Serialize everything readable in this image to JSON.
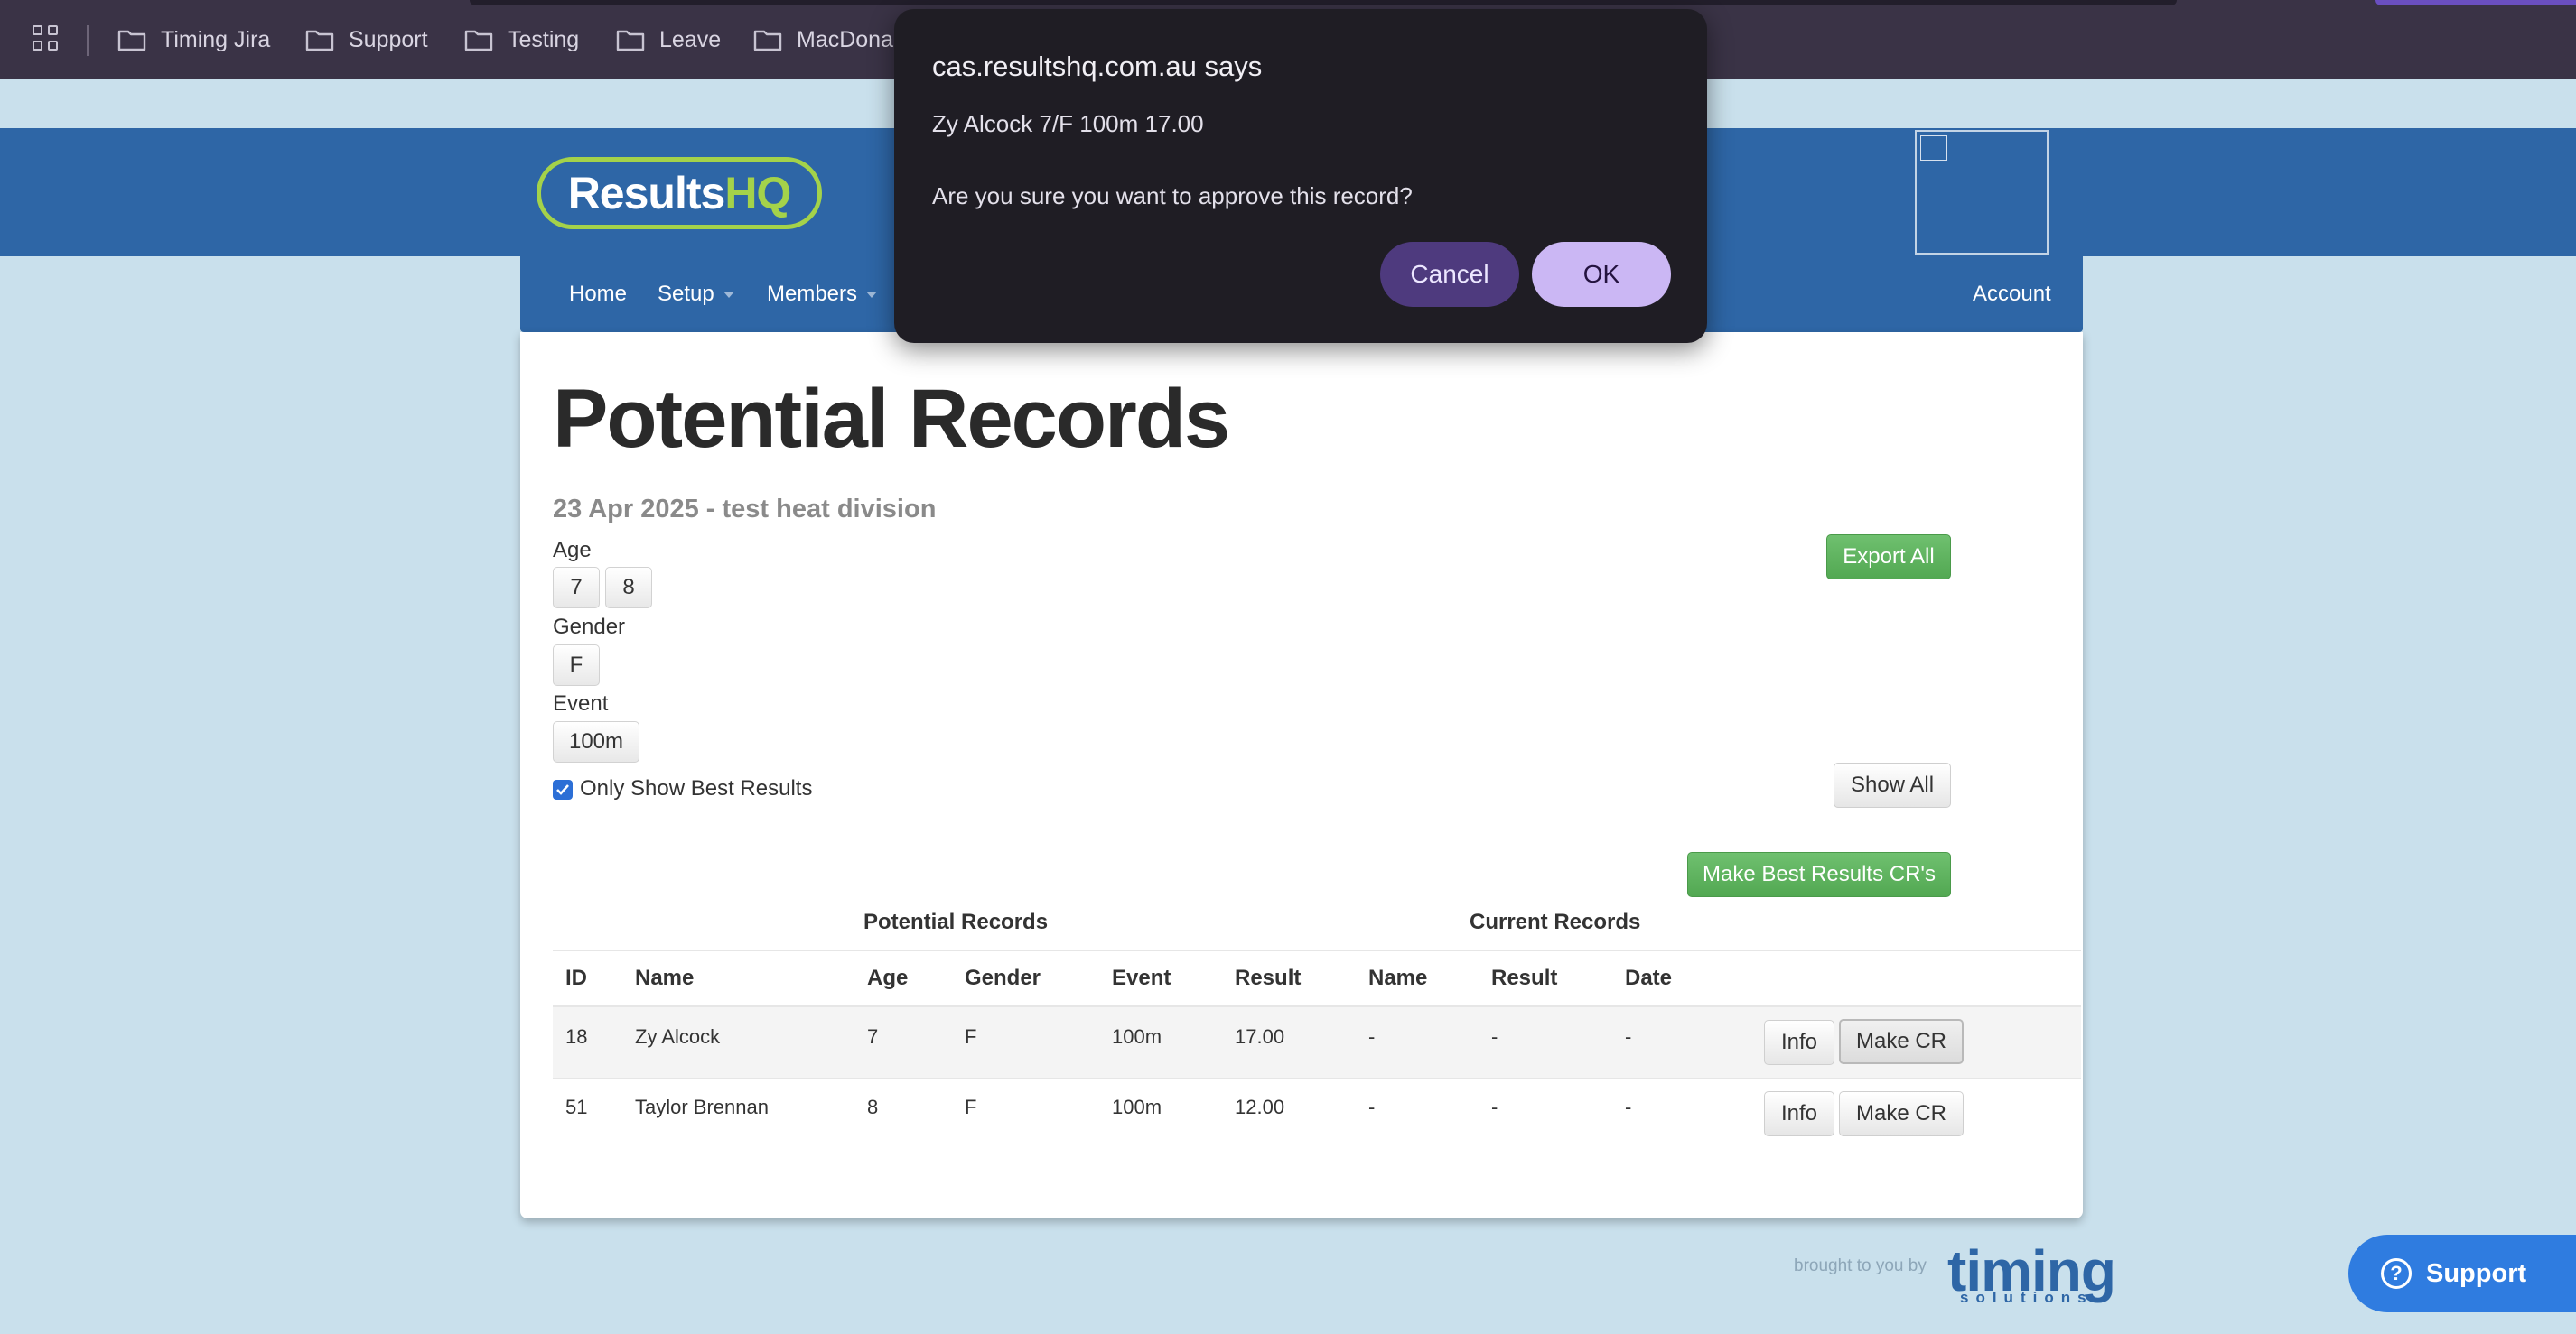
{
  "browser": {
    "bookmarks": [
      {
        "label": "Timing Jira",
        "icon": "folder-icon"
      },
      {
        "label": "Support",
        "icon": "folder-icon"
      },
      {
        "label": "Testing",
        "icon": "folder-icon"
      },
      {
        "label": "Leave",
        "icon": "folder-icon"
      },
      {
        "label": "MacDonal",
        "icon": "folder-icon"
      }
    ]
  },
  "site": {
    "logo": {
      "part1": "Results",
      "part2": "HQ"
    },
    "brand_colors": {
      "primary": "#2e66a6",
      "logo_green": "#a4d24a",
      "success": "#5cb85c"
    }
  },
  "nav": {
    "home": "Home",
    "setup": "Setup",
    "members": "Members",
    "account": "Account"
  },
  "page": {
    "title": "Potential Records",
    "subtitle": "23 Apr 2025 - test heat division",
    "filters": {
      "age_label": "Age",
      "ages": [
        "7",
        "8"
      ],
      "gender_label": "Gender",
      "genders": [
        "F"
      ],
      "event_label": "Event",
      "events": [
        "100m"
      ]
    },
    "only_best_label": "Only Show Best Results",
    "only_best_checked": true,
    "export_all": "Export All",
    "show_all": "Show All",
    "make_best_cr": "Make Best Results CR's"
  },
  "table": {
    "group_potential": "Potential Records",
    "group_current": "Current Records",
    "headers": [
      "ID",
      "Name",
      "Age",
      "Gender",
      "Event",
      "Result",
      "Name",
      "Result",
      "Date"
    ],
    "rows": [
      {
        "id": "18",
        "name": "Zy Alcock",
        "age": "7",
        "gender": "F",
        "event": "100m",
        "result": "17.00",
        "cur_name": "-",
        "cur_result": "-",
        "cur_date": "-",
        "info": "Info",
        "make_cr": "Make CR"
      },
      {
        "id": "51",
        "name": "Taylor Brennan",
        "age": "8",
        "gender": "F",
        "event": "100m",
        "result": "12.00",
        "cur_name": "-",
        "cur_result": "-",
        "cur_date": "-",
        "info": "Info",
        "make_cr": "Make CR"
      }
    ]
  },
  "footer": {
    "brought_by": "brought to you by",
    "timing_logo": "timing",
    "timing_sub": "solutions",
    "support": "Support"
  },
  "dialog": {
    "title": "cas.resultshq.com.au says",
    "message_line1": "Zy Alcock 7/F 100m 17.00",
    "message_line2": "Are you sure you want to approve this record?",
    "cancel": "Cancel",
    "ok": "OK"
  }
}
